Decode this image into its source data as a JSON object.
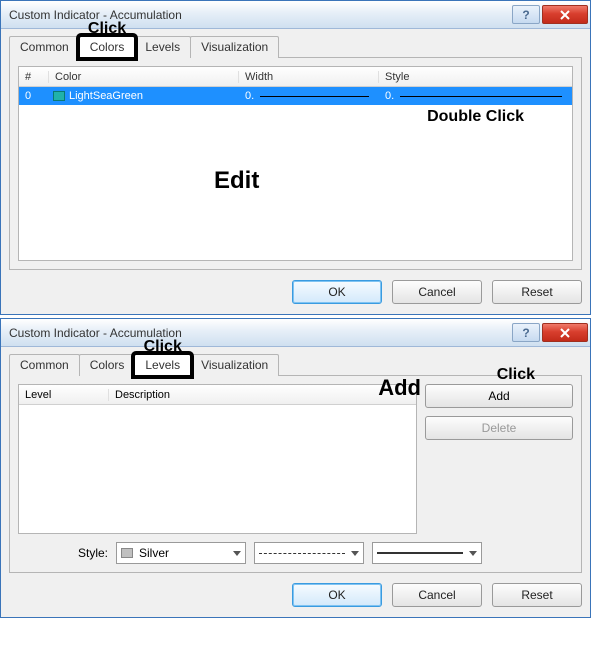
{
  "windows": [
    {
      "title": "Custom Indicator - Accumulation",
      "tabs": [
        "Common",
        "Colors",
        "Levels",
        "Visualization"
      ],
      "active_tab": 1,
      "click_annotation": "Click",
      "columns": {
        "num": "#",
        "color": "Color",
        "width": "Width",
        "style": "Style"
      },
      "row": {
        "index": "0",
        "color_name": "LightSeaGreen",
        "width_label": "0.",
        "style_label": "0."
      },
      "double_click_annotation": "Double Click",
      "edit_annotation": "Edit",
      "buttons": {
        "ok": "OK",
        "cancel": "Cancel",
        "reset": "Reset"
      }
    },
    {
      "title": "Custom Indicator - Accumulation",
      "tabs": [
        "Common",
        "Colors",
        "Levels",
        "Visualization"
      ],
      "active_tab": 2,
      "click_annotation": "Click",
      "columns": {
        "level": "Level",
        "description": "Description"
      },
      "add_annotation": "Add",
      "side_click_annotation": "Click",
      "side_buttons": {
        "add": "Add",
        "delete": "Delete"
      },
      "style_label": "Style:",
      "style_color": "Silver",
      "buttons": {
        "ok": "OK",
        "cancel": "Cancel",
        "reset": "Reset"
      }
    }
  ]
}
